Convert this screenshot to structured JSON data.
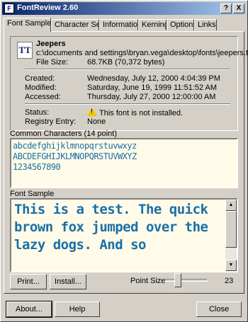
{
  "window": {
    "title": "FontReview 2.60",
    "help_btn": "?",
    "close_btn": "X"
  },
  "tabs": [
    {
      "label": "Font Sample"
    },
    {
      "label": "Character Set"
    },
    {
      "label": "Information"
    },
    {
      "label": "Kerning"
    },
    {
      "label": "Options"
    },
    {
      "label": "Links"
    }
  ],
  "font": {
    "icon": "TT",
    "name": "Jeepers",
    "path": "c:\\documents and settings\\bryan.vega\\desktop\\fonts\\jeepers.ttf",
    "file_size_label": "File Size:",
    "file_size": "68.7KB (70,372 bytes)",
    "created_label": "Created:",
    "created": "Wednesday, July 12, 2000 4:04:39 PM",
    "modified_label": "Modified:",
    "modified": "Saturday, June 19, 1999 11:51:52 AM",
    "accessed_label": "Accessed:",
    "accessed": "Thursday, July 27, 2000 12:00:00 AM",
    "status_label": "Status:",
    "status": "This font is not installed.",
    "registry_label": "Registry Entry:",
    "registry": "None"
  },
  "common_chars": {
    "label": "Common Characters (14 point)",
    "line1": "abcdefghijklmnopqrstuvwxyz",
    "line2": "ABCDEFGHIJKLMNOPQRSTUVWXYZ",
    "line3": "1234567890"
  },
  "sample": {
    "label": "Font Sample",
    "text": "This is a test. The quick brown fox jumped over the lazy dogs. And so"
  },
  "buttons": {
    "print": "Print...",
    "install": "Install...",
    "about": "About...",
    "help": "Help",
    "close": "Close"
  },
  "point_size": {
    "label": "Point Size",
    "value": "23"
  }
}
